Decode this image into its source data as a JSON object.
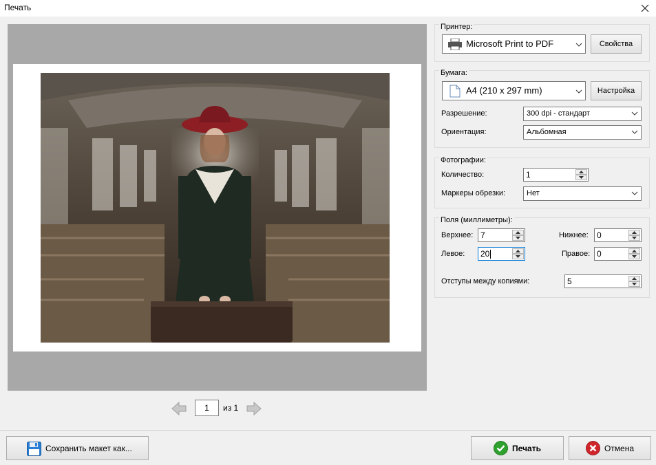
{
  "window": {
    "title": "Печать"
  },
  "preview": {
    "page_current": "1",
    "page_of": "из 1"
  },
  "printer": {
    "group_label": "Принтер:",
    "selected": "Microsoft Print to PDF",
    "properties_button": "Свойства"
  },
  "paper": {
    "group_label": "Бумага:",
    "selected": "A4 (210 x 297 mm)",
    "setup_button": "Настройка",
    "resolution_label": "Разрешение:",
    "resolution_value": "300 dpi - стандарт",
    "orientation_label": "Ориентация:",
    "orientation_value": "Альбомная"
  },
  "photos": {
    "group_label": "Фотографии:",
    "count_label": "Количество:",
    "count_value": "1",
    "crop_marks_label": "Маркеры обрезки:",
    "crop_marks_value": "Нет"
  },
  "margins": {
    "group_label": "Поля (миллиметры):",
    "top_label": "Верхнее:",
    "top_value": "7",
    "bottom_label": "Нижнее:",
    "bottom_value": "0",
    "left_label": "Левое:",
    "left_value": "20",
    "right_label": "Правое:",
    "right_value": "0",
    "spacing_label": "Отступы между копиями:",
    "spacing_value": "5"
  },
  "footer": {
    "save_layout_button": "Сохранить макет как...",
    "print_button": "Печать",
    "cancel_button": "Отмена"
  },
  "colors": {
    "preview_bg": "#a8a8a8",
    "accent": "#0078d7",
    "ok_green": "#2fa12f",
    "cancel_red": "#d0262b"
  }
}
